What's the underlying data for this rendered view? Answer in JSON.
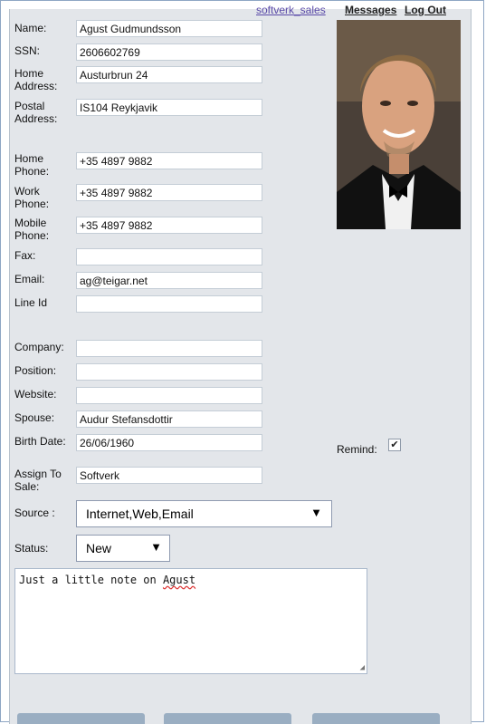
{
  "nav": {
    "user_link": "softverk_sales",
    "messages": "Messages",
    "logout": "Log Out"
  },
  "form": {
    "name": {
      "label": "Name:",
      "value": "Agust Gudmundsson"
    },
    "ssn": {
      "label": "SSN:",
      "value": "2606602769"
    },
    "home_address": {
      "label": "Home Address:",
      "value": "Austurbrun 24"
    },
    "postal_address": {
      "label": "Postal Address:",
      "value": "IS104 Reykjavik"
    },
    "home_phone": {
      "label": "Home Phone:",
      "value": "+35 4897 9882"
    },
    "work_phone": {
      "label": "Work Phone:",
      "value": "+35 4897 9882"
    },
    "mobile_phone": {
      "label": "Mobile Phone:",
      "value": "+35 4897 9882"
    },
    "fax": {
      "label": "Fax:",
      "value": ""
    },
    "email": {
      "label": "Email:",
      "value": "ag@teigar.net"
    },
    "line_id": {
      "label": "Line Id",
      "value": ""
    },
    "company": {
      "label": "Company:",
      "value": ""
    },
    "position": {
      "label": "Position:",
      "value": ""
    },
    "website": {
      "label": "Website:",
      "value": ""
    },
    "spouse": {
      "label": "Spouse:",
      "value": "Audur Stefansdottir"
    },
    "birth_date": {
      "label": "Birth Date:",
      "value": "26/06/1960"
    },
    "remind": {
      "label": "Remind:",
      "checked": true
    },
    "assign_to_sale": {
      "label": "Assign To Sale:",
      "value": "Softverk"
    },
    "source": {
      "label": "Source :",
      "value": "Internet,Web,Email"
    },
    "status": {
      "label": "Status:",
      "value": "New"
    },
    "note": {
      "text_before": "Just a little note on ",
      "text_flagged": "Agust"
    }
  },
  "photo": {
    "alt": "Contact photo"
  },
  "colors": {
    "panel": "#e3e6ea",
    "input_border": "#c4cdd6",
    "button": "#9aaec2"
  }
}
